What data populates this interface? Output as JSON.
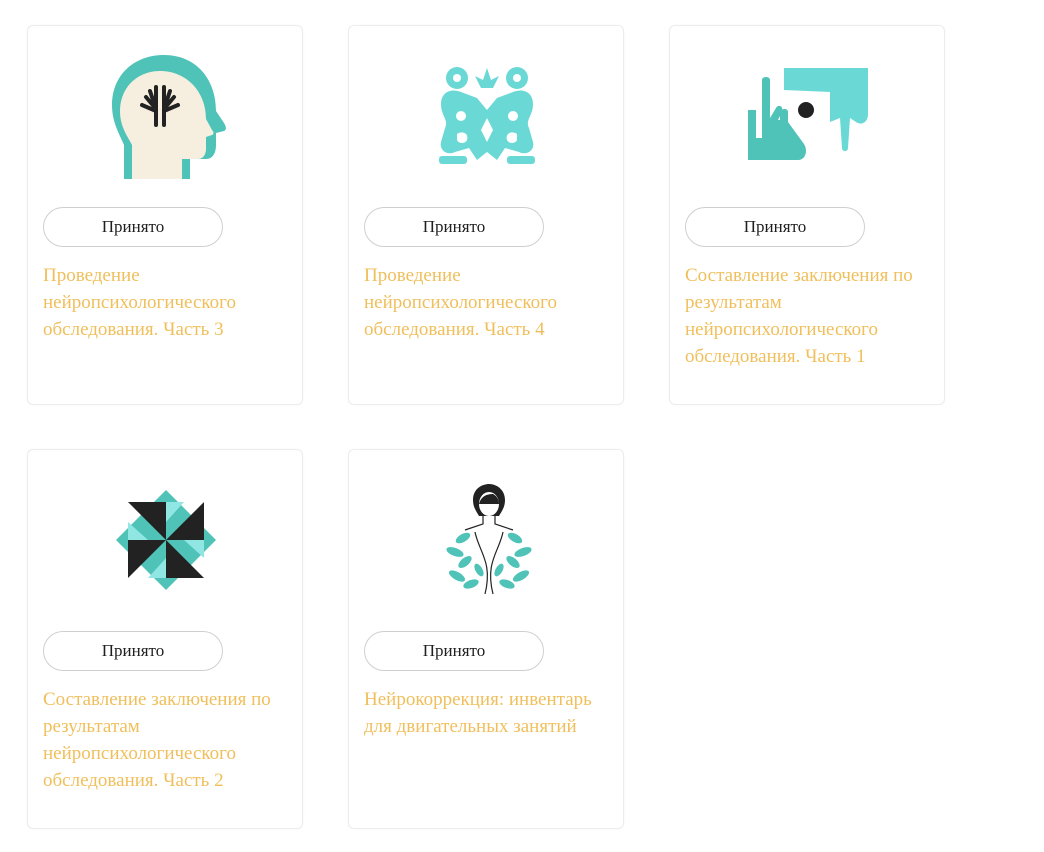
{
  "colors": {
    "teal": "#4fc3b8",
    "light_teal": "#6ad9d5",
    "dark": "#222222",
    "title_orange": "#f0bf5b",
    "head_cream": "#f6efe0"
  },
  "courses": [
    {
      "status": "Принято",
      "title": "Проведение нейропсихологического обследования. Часть 3",
      "icon": "head-hands-icon"
    },
    {
      "status": "Принято",
      "title": "Проведение нейропсихологического обследования. Часть 4",
      "icon": "symmetric-figures-icon"
    },
    {
      "status": "Принято",
      "title": "Составление заключения по результатам нейропсихологического обследования. Часть 1",
      "icon": "hand-frame-icon"
    },
    {
      "status": "Принято",
      "title": "Составление заключения по результатам нейропсихологического обследования. Часть 2",
      "icon": "pinwheel-icon"
    },
    {
      "status": "Принято",
      "title": "Нейрокоррекция: инвентарь для двигательных занятий",
      "icon": "woman-leaves-icon"
    }
  ]
}
